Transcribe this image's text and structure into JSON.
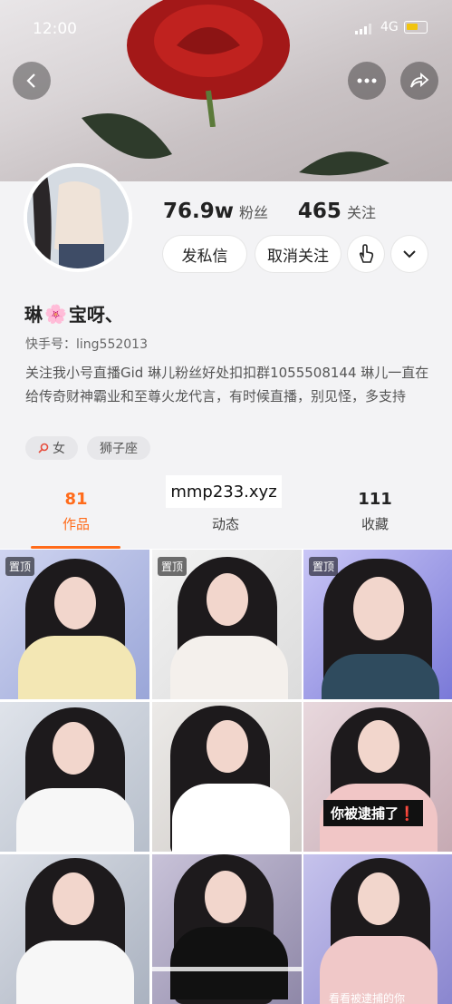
{
  "status_bar": {
    "time": "12:00",
    "network": "4G"
  },
  "header": {
    "back_icon": "chevron-left-icon",
    "more_icon": "more-dots-icon",
    "share_icon": "share-arrow-icon"
  },
  "profile": {
    "fans_count": "76.9w",
    "fans_label": "粉丝",
    "following_count": "465",
    "following_label": "关注",
    "message_button": "发私信",
    "unfollow_button": "取消关注",
    "name": "琳",
    "name_suffix": "宝呀、",
    "name_emoji": "🌸",
    "kuaishou_id": "快手号：ling552013",
    "bio": "关注我小号直播Gid  琳儿粉丝好处扣扣群1055508144 琳儿一直在给传奇财神霸业和至尊火龙代言，有时候直播，别见怪，多支持",
    "tags": [
      "女",
      "狮子座"
    ]
  },
  "tabs": [
    {
      "count": "81",
      "label": "作品",
      "active": true
    },
    {
      "count": "",
      "label": "动态",
      "active": false
    },
    {
      "count": "111",
      "label": "收藏",
      "active": false
    }
  ],
  "watermark": "mmp233.xyz",
  "grid": {
    "pinned_label": "置顶",
    "caption_text": "你被逮捕了❗",
    "caption_small": "看看被逮捕的你"
  },
  "colors": {
    "accent": "#ff6b1a",
    "panel_bg": "#f3f3f5"
  }
}
